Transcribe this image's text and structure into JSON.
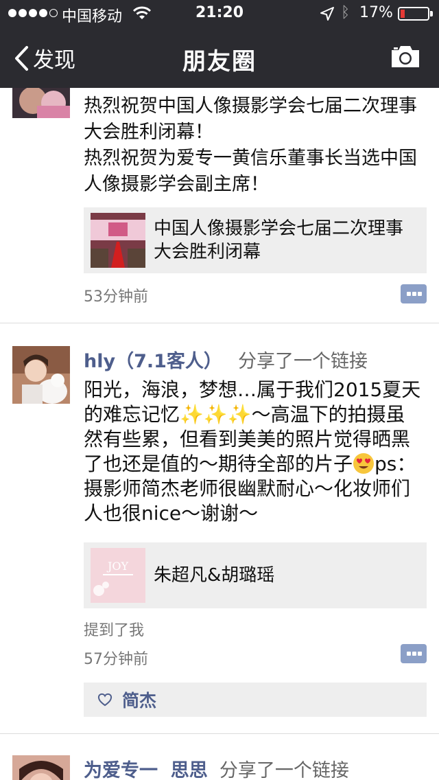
{
  "status_bar": {
    "carrier": "中国移动",
    "time": "21:20",
    "battery_percent": "17%",
    "battery_level": 0.17,
    "signal_dots_filled": 4,
    "signal_dots_total": 5
  },
  "nav": {
    "back_label": "发现",
    "title": "朋友圈",
    "camera_icon": "camera-icon"
  },
  "posts": [
    {
      "text": "热烈祝贺中国人像摄影学会七届二次理事大会胜利闭幕！\n热烈祝贺为爱专一黄信乐董事长当选中国人像摄影学会副主席！",
      "link_title": "中国人像摄影学会七届二次理事大会胜利闭幕",
      "time": "53分钟前"
    },
    {
      "author": "hly（7.1客人）",
      "action": "分享了一个链接",
      "text_part1": "阳光，海浪，梦想…属于我们2015夏天的难忘记忆",
      "sparkles": "✨✨✨",
      "text_part2": "～高温下的拍摄虽然有些累，但看到美美的照片觉得晒黑了也还是值的～期待全部的片子",
      "text_part3": "ps：摄影师简杰老师很幽默耐心～化妆师们人也很nice～谢谢～",
      "link_title": "朱超凡&胡璐瑶",
      "mention": "提到了我",
      "time": "57分钟前",
      "likes": [
        "简杰"
      ]
    },
    {
      "author": "为爱专一  思思",
      "action": "分享了一个链接"
    }
  ],
  "colors": {
    "bar_bg": "#2b2b30",
    "author": "#4e5e8c",
    "comment_button": "#8b9fc7"
  }
}
